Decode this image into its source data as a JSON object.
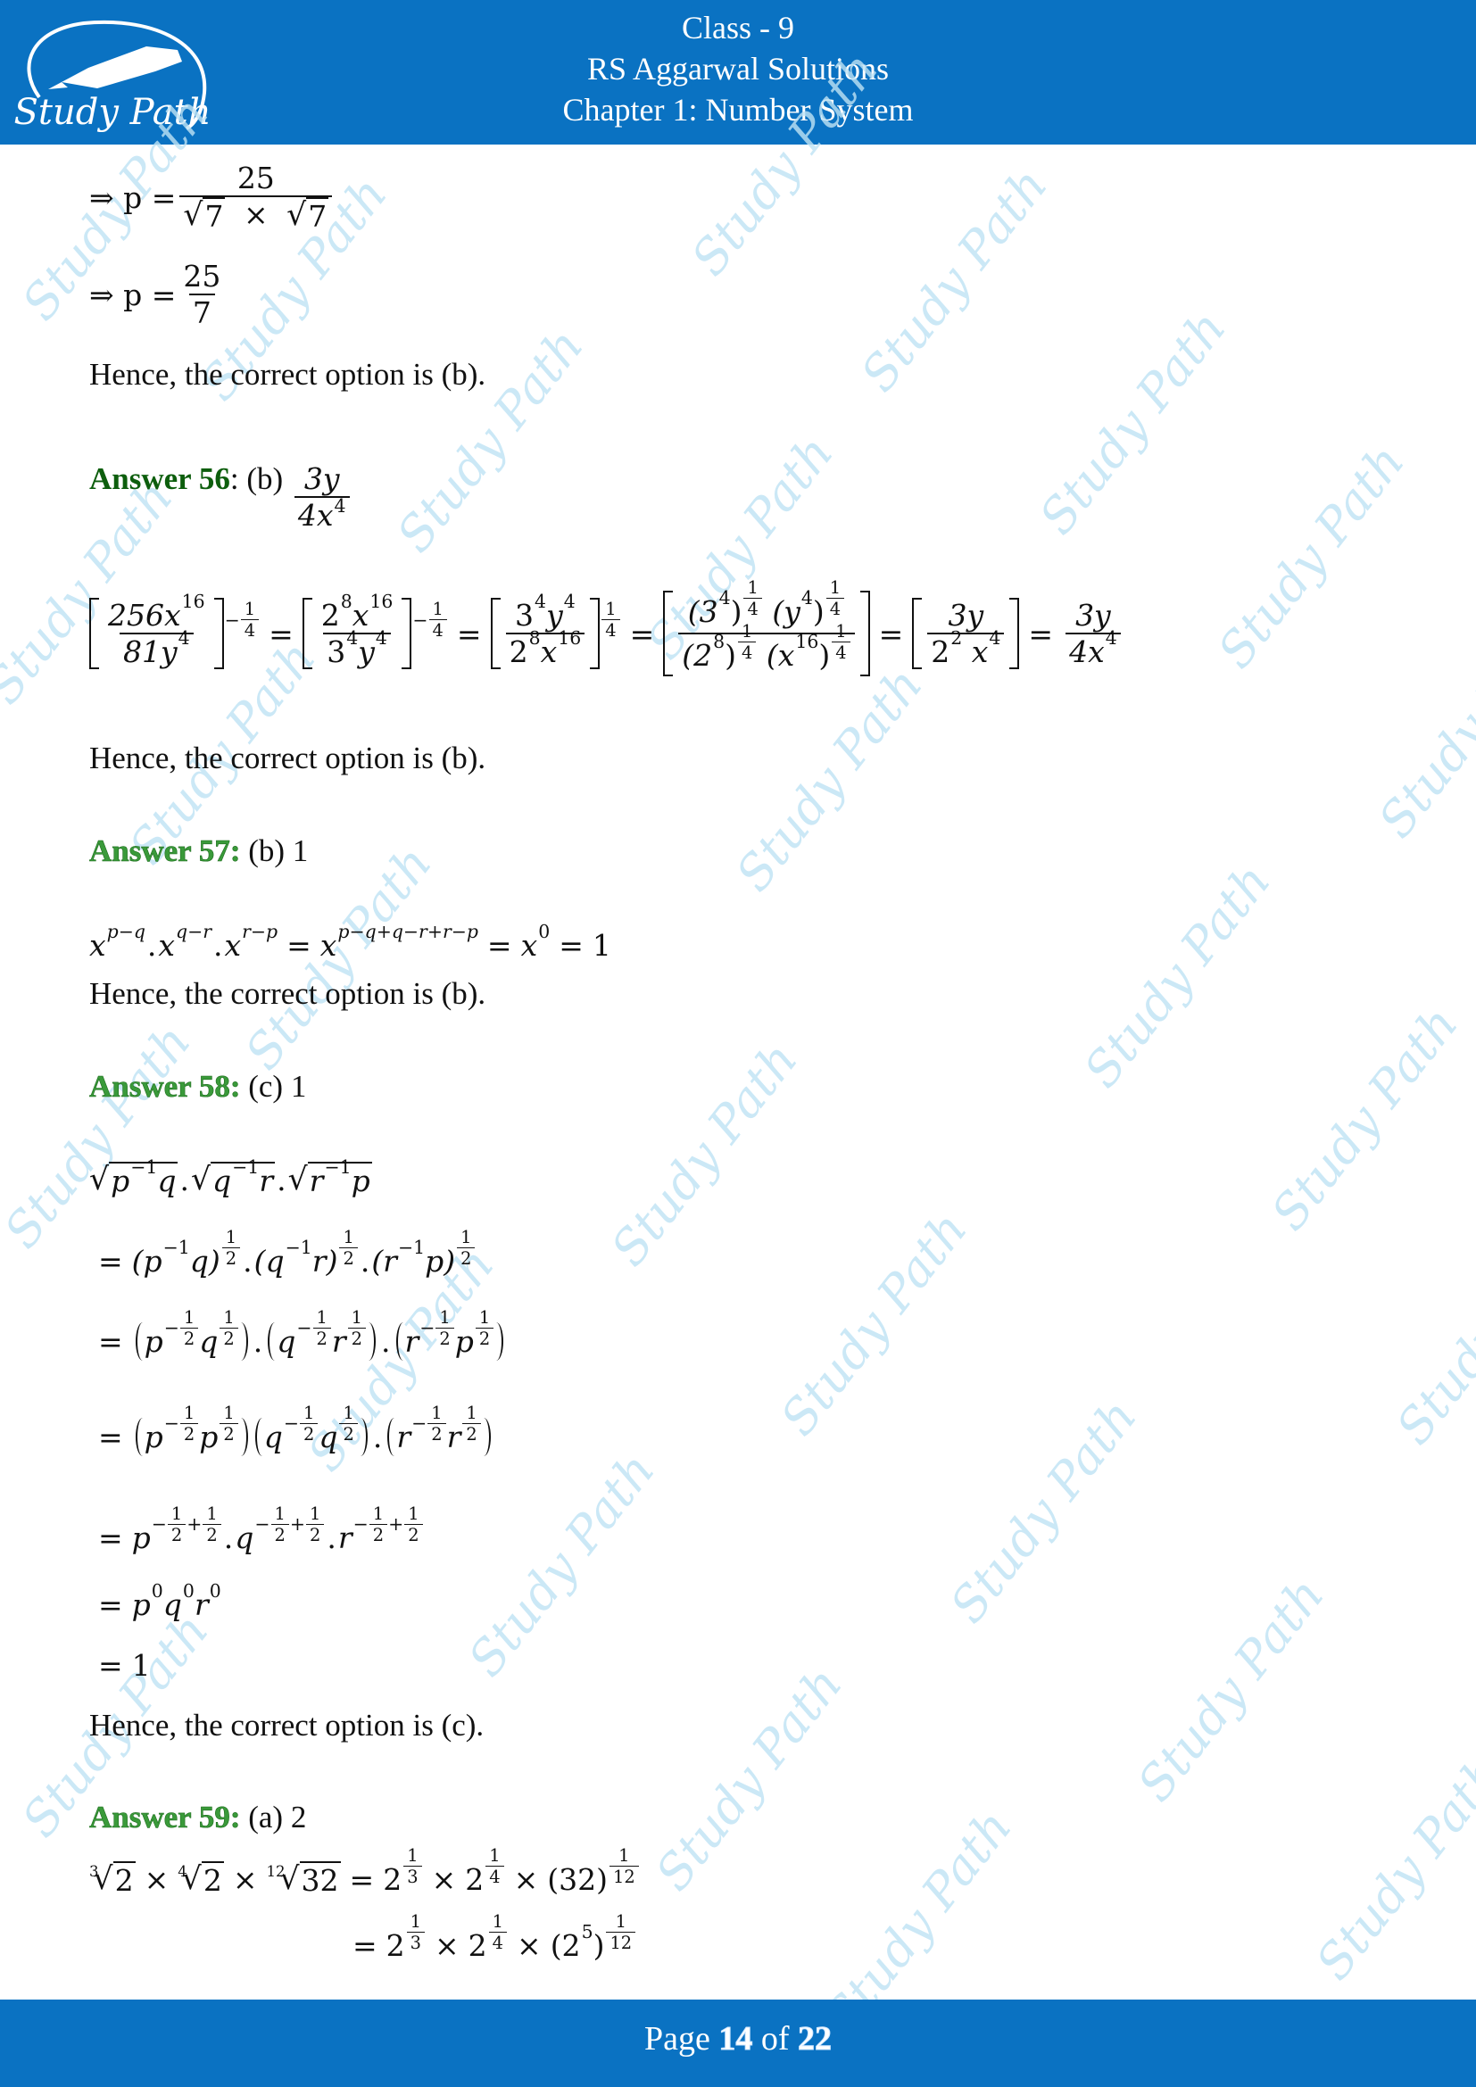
{
  "header": {
    "logo_text": "Study Path",
    "title_lines": [
      "Class - 9",
      "RS Aggarwal Solutions",
      "Chapter 1: Number System"
    ],
    "background_color": "#0a72c2"
  },
  "watermark": {
    "text": "Study Path",
    "color": "#bfe3f5"
  },
  "footer": {
    "prefix": "Page",
    "current": "14",
    "of": "of",
    "total": "22"
  },
  "content": {
    "prev_tail": {
      "line1": {
        "lhs": "⇒ p =",
        "num": "25",
        "den_a": "7",
        "times": "×",
        "den_b": "7"
      },
      "line2": {
        "lhs": "⇒ p =",
        "num": "25",
        "den": "7"
      },
      "conclusion": "Hence, the correct option is (b)."
    },
    "answers": [
      {
        "label": "Answer 56",
        "sep": ":",
        "option": "(b)",
        "result": {
          "num": "3y",
          "den_base": "4x",
          "den_exp": "4"
        },
        "steps": {
          "s1": {
            "num_base": "256x",
            "num_exp": "16",
            "den_base": "81y",
            "den_exp": "4",
            "outer_sign": "−",
            "outer_num": "1",
            "outer_den": "4"
          },
          "s2": {
            "num": [
              "2",
              "8",
              "x",
              "16"
            ],
            "den": [
              "3",
              "4",
              "y",
              "4"
            ],
            "outer_sign": "−",
            "outer_num": "1",
            "outer_den": "4"
          },
          "s3": {
            "num": [
              "3",
              "4",
              "y",
              "4"
            ],
            "den": [
              "2",
              "8",
              "x",
              "16"
            ],
            "outer_num": "1",
            "outer_den": "4"
          },
          "s4": {
            "num": [
              "(3",
              "4",
              ")",
              "(y",
              "4",
              ")"
            ],
            "den": [
              "(2",
              "8",
              ")",
              "(x",
              "16",
              ")"
            ],
            "exp_num": "1",
            "exp_den": "4"
          },
          "s5": {
            "num": "3y",
            "den": [
              "2",
              "2",
              "x",
              "4"
            ]
          },
          "s6": {
            "num": "3y",
            "den_base": "4x",
            "den_exp": "4"
          },
          "eq": "="
        },
        "conclusion": "Hence, the correct option is (b)."
      },
      {
        "label": "Answer 57",
        "sep": ":",
        "option": "(b) 1",
        "equation": {
          "terms": [
            {
              "base": "x",
              "exp": "p−q"
            },
            {
              "base": "x",
              "exp": "q−r"
            },
            {
              "base": "x",
              "exp": "r−p"
            }
          ],
          "dot": ".",
          "rhs1": {
            "base": "x",
            "exp": "p−q+q−r+r−p"
          },
          "rhs2": {
            "base": "x",
            "exp": "0"
          },
          "rhs3": "1",
          "eq": "="
        },
        "conclusion": "Hence, the correct option is (b)."
      },
      {
        "label": "Answer 58",
        "sep": ":",
        "option": "(c) 1",
        "lines": {
          "l1": [
            [
              "p",
              "−1",
              "q"
            ],
            [
              "q",
              "−1",
              "r"
            ],
            [
              "r",
              "−1",
              "p"
            ]
          ],
          "l2": [
            [
              "(p",
              "−1",
              "q)"
            ],
            [
              "(q",
              "−1",
              "r)"
            ],
            [
              "(r",
              "−1",
              "p)"
            ]
          ],
          "l3": [
            [
              "p",
              "q"
            ],
            [
              "q",
              "r"
            ],
            [
              "r",
              "p"
            ]
          ],
          "l4": [
            [
              "p",
              "p"
            ],
            [
              "q",
              "q"
            ],
            [
              "r",
              "r"
            ]
          ],
          "l5": [
            "p",
            "q",
            "r"
          ],
          "l6": [
            "p",
            "q",
            "r"
          ],
          "l6_exp": "0",
          "l7": "1",
          "half_num": "1",
          "half_den": "2",
          "minus": "−",
          "plus": "+",
          "dot": ".",
          "eq": "="
        },
        "conclusion": "Hence, the correct option is (c)."
      },
      {
        "label": "Answer 59",
        "sep": ":",
        "option": "(a) 2",
        "line1": {
          "roots": [
            {
              "index": "3",
              "radicand": "2"
            },
            {
              "index": "4",
              "radicand": "2"
            },
            {
              "index": "12",
              "radicand": "32"
            }
          ],
          "rhs": [
            {
              "base": "2",
              "den": "3"
            },
            {
              "base": "2",
              "den": "4"
            },
            {
              "base": "(32)",
              "den": "12"
            }
          ],
          "times": "×",
          "eq": "=",
          "one": "1"
        },
        "line2": {
          "rhs": [
            {
              "base": "2",
              "den": "3"
            },
            {
              "base": "2",
              "den": "4"
            },
            {
              "base_open": "(2",
              "base_exp": "5",
              "base_close": ")",
              "den": "12"
            }
          ],
          "times": "×",
          "eq": "=",
          "one": "1"
        }
      }
    ]
  }
}
